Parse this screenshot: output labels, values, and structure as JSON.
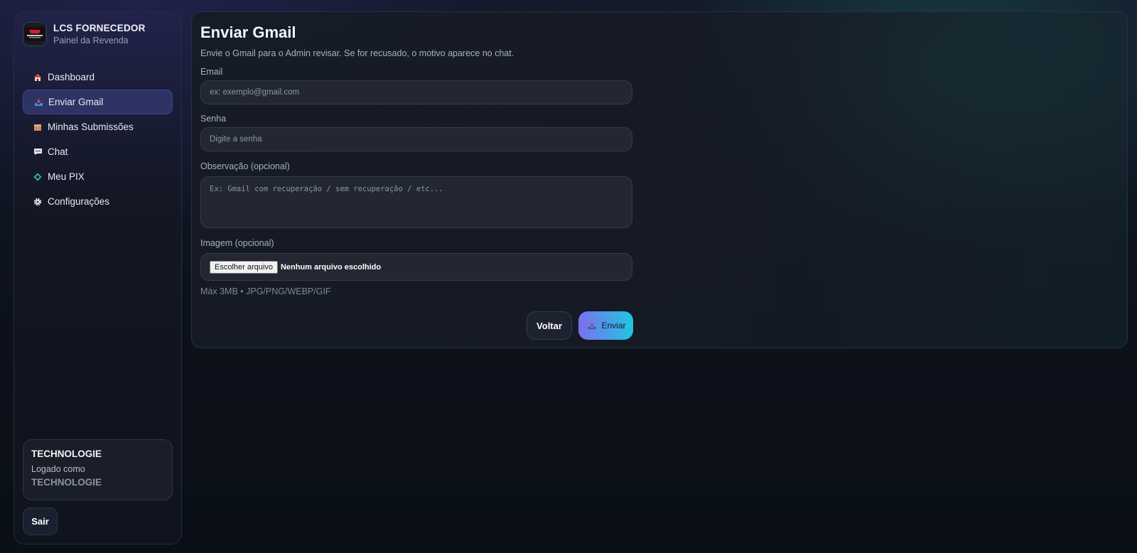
{
  "brand": {
    "title": "LCS FORNECEDOR",
    "subtitle": "Painel da Revenda"
  },
  "nav": [
    {
      "label": "Dashboard",
      "icon": "house-icon",
      "active": false
    },
    {
      "label": "Enviar Gmail",
      "icon": "inbox-tray-icon",
      "active": true
    },
    {
      "label": "Minhas Submissões",
      "icon": "package-icon",
      "active": false
    },
    {
      "label": "Chat",
      "icon": "speech-bubble-icon",
      "active": false
    },
    {
      "label": "Meu PIX",
      "icon": "pix-diamond-icon",
      "active": false
    },
    {
      "label": "Configurações",
      "icon": "gear-icon",
      "active": false
    }
  ],
  "user": {
    "name": "TECHNOLOGIE",
    "label": "Logado como",
    "login": "TECHNOLOGIE"
  },
  "logout_label": "Sair",
  "main": {
    "title": "Enviar Gmail",
    "description": "Envie o Gmail para o Admin revisar. Se for recusado, o motivo aparece no chat.",
    "email": {
      "label": "Email",
      "placeholder": "ex: exemplo@gmail.com",
      "value": ""
    },
    "password": {
      "label": "Senha",
      "placeholder": "Digite a senha",
      "value": ""
    },
    "note": {
      "label": "Observação (opcional)",
      "placeholder": "Ex: Gmail com recuperação / sem recuperação / etc..."
    },
    "image": {
      "label": "Imagem (opcional)",
      "button": "Escolher arquivo",
      "status": "Nenhum arquivo escolhido",
      "hint": "Máx 3MB • JPG/PNG/WEBP/GIF"
    },
    "back_label": "Voltar",
    "send_label": "Enviar"
  },
  "colors": {
    "accent_start": "#7b6ff0",
    "accent_end": "#21c6e0",
    "active_nav": "#2e3366"
  }
}
